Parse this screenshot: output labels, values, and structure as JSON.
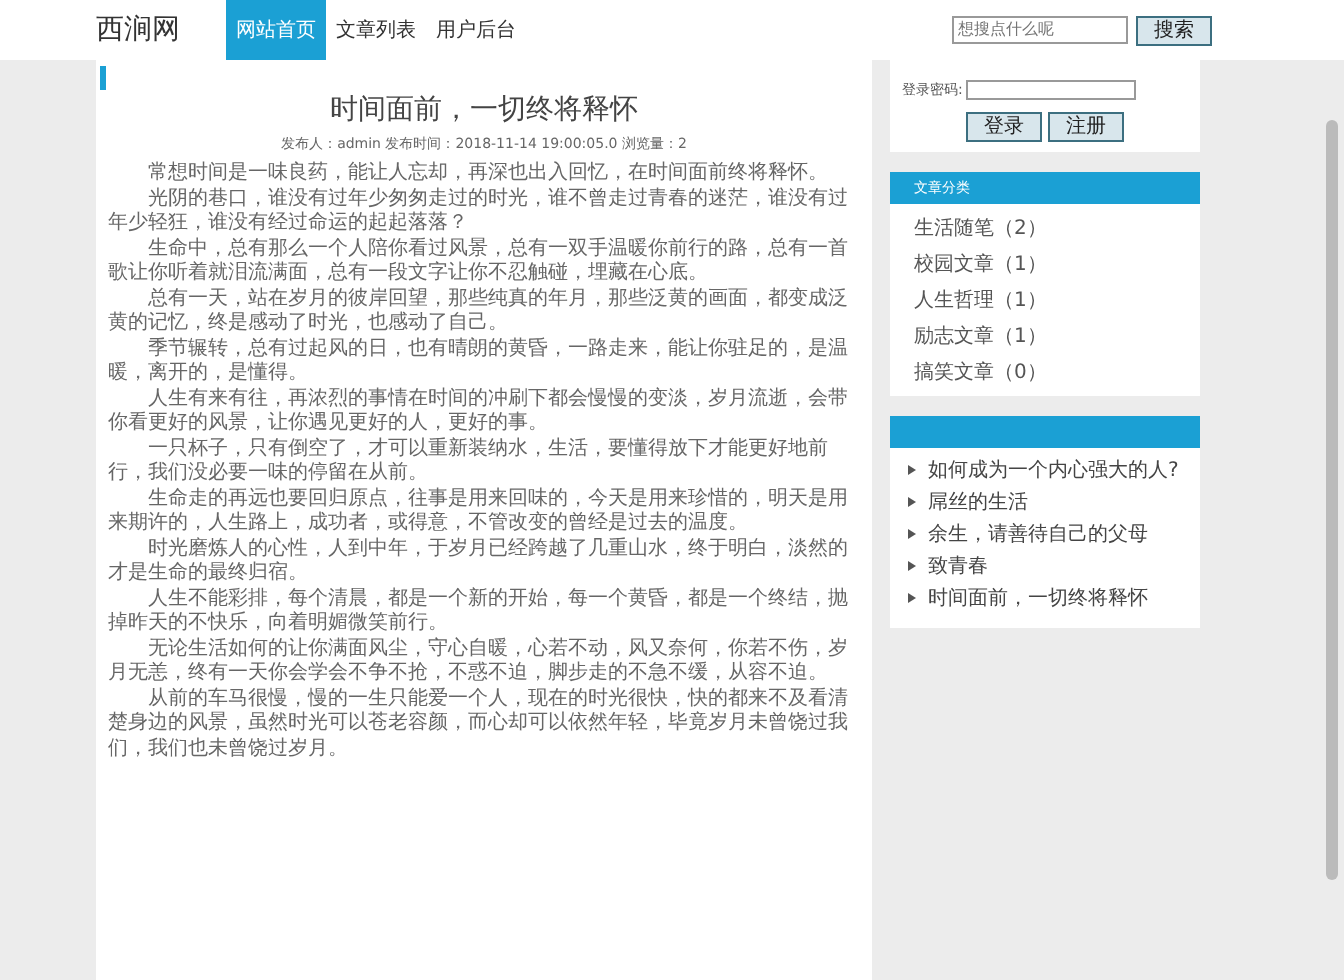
{
  "nav": {
    "logo": "西涧网",
    "tabs": [
      {
        "label": "网站首页",
        "selected": true
      },
      {
        "label": "文章列表",
        "selected": false
      },
      {
        "label": "用户后台",
        "selected": false
      }
    ],
    "search": {
      "placeholder": "想搜点什么呢",
      "button": "搜索"
    }
  },
  "article": {
    "title": "时间面前，一切终将释怀",
    "meta": "发布人：admin  发布时间：2018-11-14 19:00:05.0  浏览量：2",
    "paragraphs": [
      "常想时间是一味良药，能让人忘却，再深也出入回忆，在时间面前终将释怀。",
      "光阴的巷口，谁没有过年少匆匆走过的时光，谁不曾走过青春的迷茫，谁没有过年少轻狂，谁没有经过命运的起起落落？",
      "生命中，总有那么一个人陪你看过风景，总有一双手温暖你前行的路，总有一首歌让你听着就泪流满面，总有一段文字让你不忍触碰，埋藏在心底。",
      "总有一天，站在岁月的彼岸回望，那些纯真的年月，那些泛黄的画面，都变成泛黄的记忆，终是感动了时光，也感动了自己。",
      "季节辗转，总有过起风的日，也有晴朗的黄昏，一路走来，能让你驻足的，是温暖，离开的，是懂得。",
      "人生有来有往，再浓烈的事情在时间的冲刷下都会慢慢的变淡，岁月流逝，会带你看更好的风景，让你遇见更好的人，更好的事。",
      "一只杯子，只有倒空了，才可以重新装纳水，生活，要懂得放下才能更好地前行，我们没必要一味的停留在从前。",
      "生命走的再远也要回归原点，往事是用来回味的，今天是用来珍惜的，明天是用来期许的，人生路上，成功者，或得意，不管改变的曾经是过去的温度。",
      "时光磨炼人的心性，人到中年，于岁月已经跨越了几重山水，终于明白，淡然的才是生命的最终归宿。",
      "人生不能彩排，每个清晨，都是一个新的开始，每一个黄昏，都是一个终结，抛掉昨天的不快乐，向着明媚微笑前行。",
      "无论生活如何的让你满面风尘，守心自暖，心若不动，风又奈何，你若不伤，岁月无恙，终有一天你会学会不争不抢，不惑不迫，脚步走的不急不缓，从容不迫。",
      "从前的车马很慢，慢的一生只能爱一个人，现在的时光很快，快的都来不及看清楚身边的风景，虽然时光可以苍老容颜，而心却可以依然年轻，毕竟岁月未曾饶过我们，我们也未曾饶过岁月。"
    ]
  },
  "login": {
    "password_label": "登录密码:",
    "buttons": [
      "登录",
      "注册"
    ]
  },
  "categories": {
    "title": "文章分类",
    "items": [
      "生活随笔（2）",
      "校园文章（1）",
      "人生哲理（1）",
      "励志文章（1）",
      "搞笑文章（0）"
    ]
  },
  "recent": {
    "items": [
      "如何成为一个内心强大的人?",
      "屌丝的生活",
      "余生，请善待自己的父母",
      "致青春",
      "时间面前，一切终将释怀"
    ]
  }
}
